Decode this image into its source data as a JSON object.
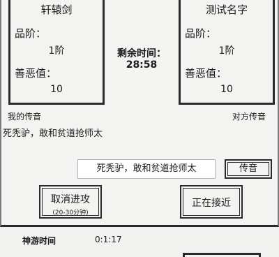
{
  "left_card": {
    "name": "轩辕剑",
    "rank_label": "品阶：",
    "rank_value": "1阶",
    "morality_label": "善恶值：",
    "morality_value": "10"
  },
  "right_card": {
    "name": "测试名字",
    "rank_label": "品阶：",
    "rank_value": "1阶",
    "morality_label": "善恶值：",
    "morality_value": "10"
  },
  "timer": {
    "label": "剩余时间：",
    "value": "28:58"
  },
  "chat": {
    "my_label": "我的传音",
    "their_label": "对方传音",
    "my_message": "死秃驴，敢和贫道抢师太",
    "input_value": "死秃驴，敢和贫道抢师太",
    "send_label": "传音"
  },
  "actions": {
    "cancel_label": "取消进攻",
    "cancel_sub": "(20-30分钟)",
    "approach_label": "正在接近"
  },
  "trip": {
    "label": "神游时间",
    "value": "0:1:17"
  }
}
